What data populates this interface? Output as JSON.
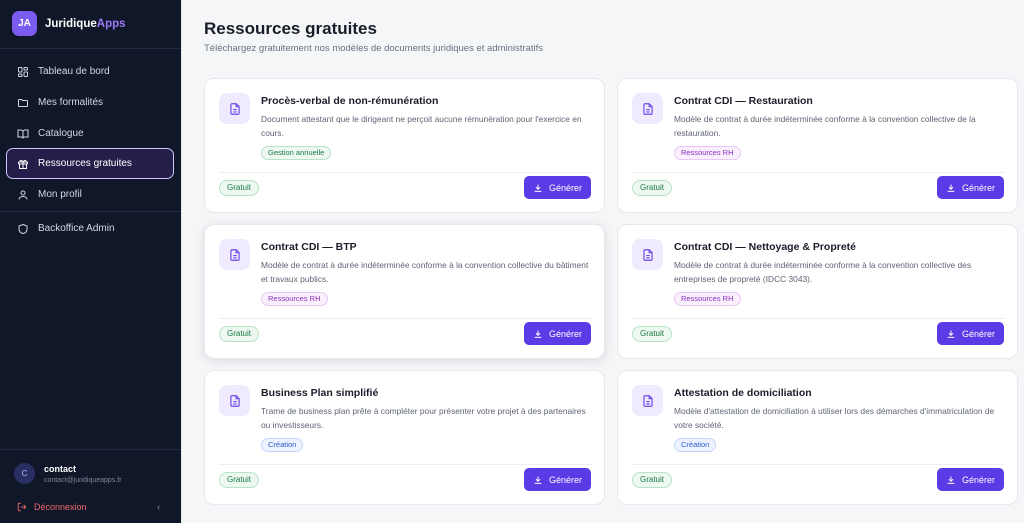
{
  "brand": {
    "logo": "JA",
    "name_main": "Juridique",
    "name_accent": "Apps"
  },
  "nav": [
    {
      "label": "Tableau de bord",
      "icon": "dashboard-icon"
    },
    {
      "label": "Mes formalités",
      "icon": "folder-icon"
    },
    {
      "label": "Catalogue",
      "icon": "book-icon"
    },
    {
      "label": "Ressources gratuites",
      "icon": "gift-icon",
      "active": true
    },
    {
      "label": "Mon profil",
      "icon": "user-icon"
    },
    {
      "label": "Backoffice Admin",
      "icon": "shield-icon"
    }
  ],
  "user": {
    "initial": "C",
    "name": "contact",
    "email": "contact@juridiqueapps.fr"
  },
  "logout_label": "Déconnexion",
  "collapse_glyph": "‹",
  "page": {
    "title": "Ressources gratuites",
    "subtitle": "Téléchargez gratuitement nos modèles de documents juridiques et administratifs"
  },
  "cards": [
    {
      "title": "Procès-verbal de non-rémunération",
      "description": "Document attestant que le dirigeant ne perçoit aucune rémunération pour l'exercice en cours.",
      "tag": "Gestion annuelle",
      "tag_color": "green",
      "badge": "Gratuit",
      "button": "Générer"
    },
    {
      "title": "Contrat CDI — Restauration",
      "description": "Modèle de contrat à durée indéterminée conforme à la convention collective de la restauration.",
      "tag": "Ressources RH",
      "tag_color": "purple",
      "badge": "Gratuit",
      "button": "Générer"
    },
    {
      "title": "Contrat CDI — BTP",
      "description": "Modèle de contrat à durée indéterminée conforme à la convention collective du bâtiment et travaux publics.",
      "tag": "Ressources RH",
      "tag_color": "purple",
      "badge": "Gratuit",
      "button": "Générer"
    },
    {
      "title": "Contrat CDI — Nettoyage & Propreté",
      "description": "Modèle de contrat à durée indéterminée conforme à la convention collective des entreprises de propreté (IDCC 3043).",
      "tag": "Ressources RH",
      "tag_color": "purple",
      "badge": "Gratuit",
      "button": "Générer"
    },
    {
      "title": "Business Plan simplifié",
      "description": "Trame de business plan prête à compléter pour présenter votre projet à des partenaires ou investisseurs.",
      "tag": "Création",
      "tag_color": "blue",
      "badge": "Gratuit",
      "button": "Générer"
    },
    {
      "title": "Attestation de domiciliation",
      "description": "Modèle d'attestation de domiciliation à utiliser lors des démarches d'immatriculation de votre société.",
      "tag": "Création",
      "tag_color": "blue",
      "badge": "Gratuit",
      "button": "Générer"
    }
  ]
}
